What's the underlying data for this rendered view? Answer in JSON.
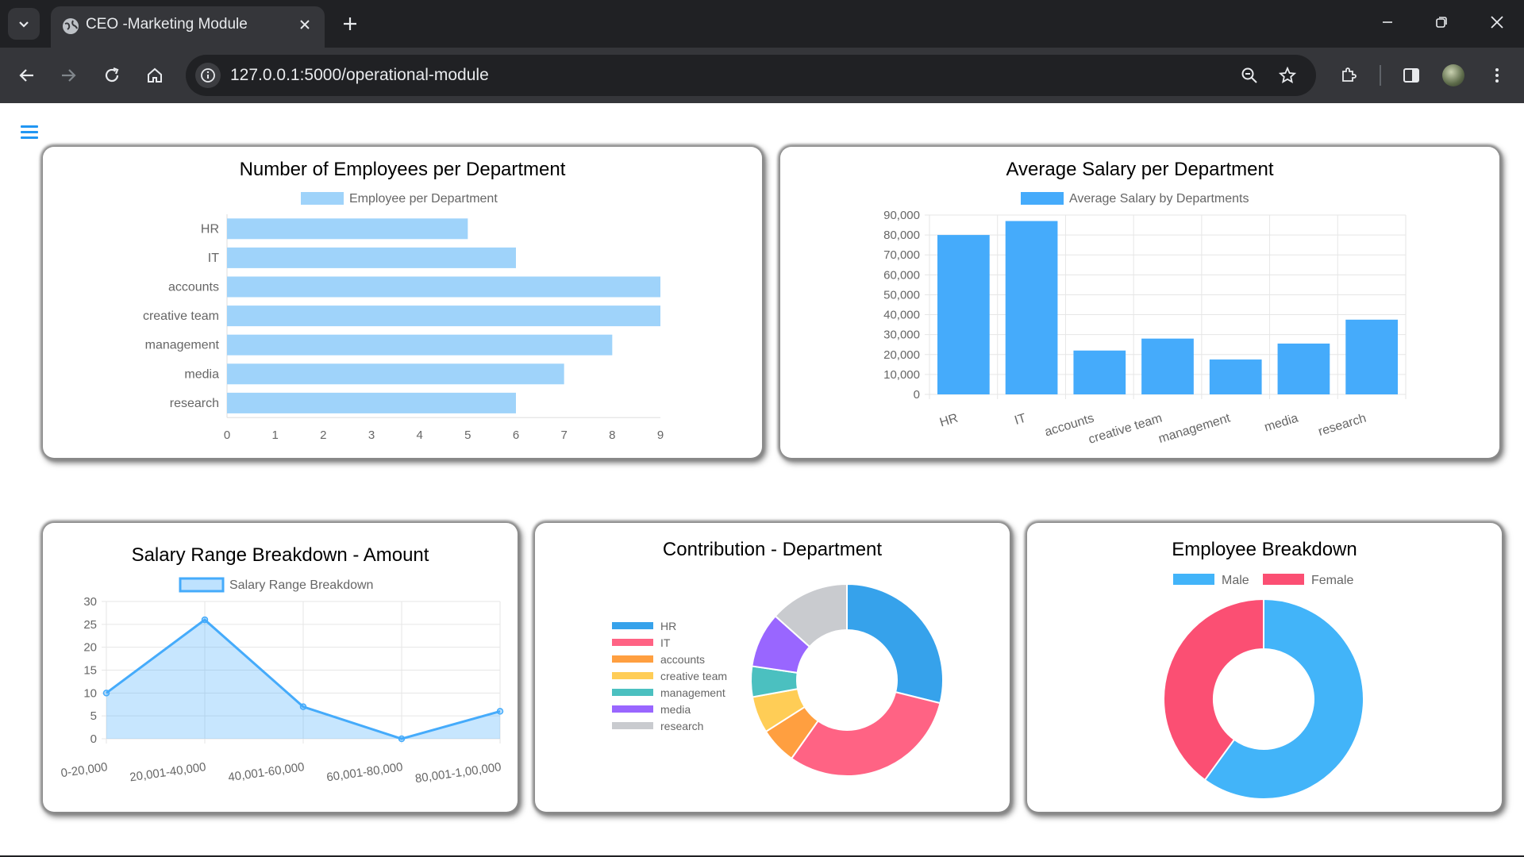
{
  "browser": {
    "tab_title": "CEO -Marketing Module",
    "url": "127.0.0.1:5000/operational-module"
  },
  "charts": {
    "employees": {
      "title": "Number of Employees per Department",
      "legend": "Employee per Department"
    },
    "salary": {
      "title": "Average Salary per Department",
      "legend": "Average Salary by Departments"
    },
    "range": {
      "title": "Salary Range Breakdown - Amount",
      "legend": "Salary Range Breakdown"
    },
    "contribution": {
      "title": "Contribution - Department"
    },
    "breakdown": {
      "title": "Employee Breakdown"
    }
  },
  "chart_data": [
    {
      "id": "employees",
      "type": "bar",
      "orientation": "horizontal",
      "title": "Number of Employees per Department",
      "categories": [
        "HR",
        "IT",
        "accounts",
        "creative team",
        "management",
        "media",
        "research"
      ],
      "series": [
        {
          "name": "Employee per Department",
          "values": [
            5,
            6,
            9,
            9,
            8,
            7,
            6
          ]
        }
      ],
      "xlim": [
        0,
        9
      ],
      "ticks": [
        "0",
        "1",
        "2",
        "3",
        "4",
        "5",
        "6",
        "7",
        "8",
        "9"
      ],
      "color": "#9fd3fa",
      "legend": "top"
    },
    {
      "id": "salary",
      "type": "bar",
      "title": "Average Salary per Department",
      "categories": [
        "HR",
        "IT",
        "accounts",
        "creative team",
        "management",
        "media",
        "research"
      ],
      "series": [
        {
          "name": "Average Salary by Departments",
          "values": [
            80000,
            87000,
            22000,
            28000,
            17500,
            25500,
            37500
          ]
        }
      ],
      "ylim": [
        0,
        90000
      ],
      "ticks": [
        "0",
        "10,000",
        "20,000",
        "30,000",
        "40,000",
        "50,000",
        "60,000",
        "70,000",
        "80,000",
        "90,000"
      ],
      "color": "#45abfb",
      "grid": true,
      "legend": "top"
    },
    {
      "id": "range",
      "type": "area",
      "title": "Salary Range Breakdown - Amount",
      "categories": [
        "0-20,000",
        "20,001-40,000",
        "40,001-60,000",
        "60,001-80,000",
        "80,001-1,00,000"
      ],
      "series": [
        {
          "name": "Salary Range Breakdown",
          "values": [
            10,
            26,
            7,
            0,
            6
          ]
        }
      ],
      "ylim": [
        0,
        30
      ],
      "ticks": [
        "0",
        "5",
        "10",
        "15",
        "20",
        "25",
        "30"
      ],
      "color": "#45abfb",
      "grid": true,
      "legend": "top"
    },
    {
      "id": "contribution",
      "type": "pie",
      "title": "Contribution - Department",
      "labels": [
        "HR",
        "IT",
        "accounts",
        "creative team",
        "management",
        "media",
        "research"
      ],
      "values": [
        28,
        30,
        6,
        6,
        5,
        9,
        13
      ],
      "colors": [
        "#36a2eb",
        "#ff6384",
        "#ff9f40",
        "#ffcd56",
        "#4bc0c0",
        "#9966ff",
        "#c9cbcf"
      ],
      "legend": "left"
    },
    {
      "id": "breakdown",
      "type": "pie",
      "title": "Employee Breakdown",
      "labels": [
        "Male",
        "Female"
      ],
      "values": [
        60,
        40
      ],
      "colors": [
        "#42b4f9",
        "#fb4f73"
      ],
      "legend": "top"
    }
  ]
}
